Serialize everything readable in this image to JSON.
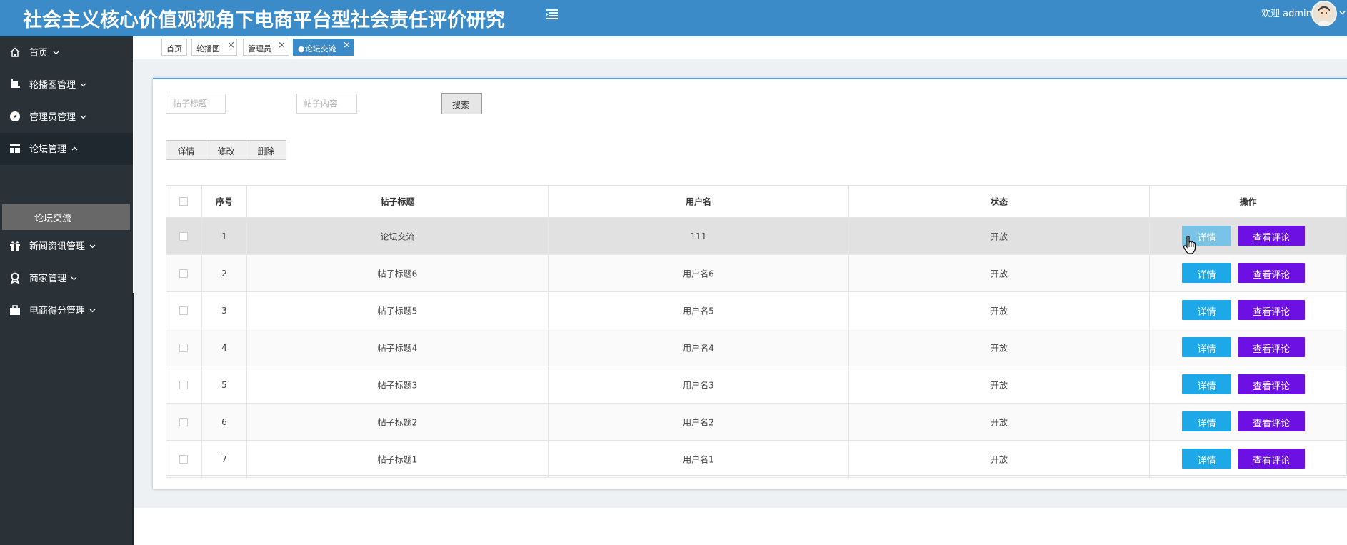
{
  "app": {
    "title": "社会主义核心价值观视角下电商平台型社会责任评价研究",
    "welcome": "欢迎 admin"
  },
  "sidebar": {
    "items": [
      {
        "label": "首页",
        "icon": "home-icon"
      },
      {
        "label": "轮播图管理",
        "icon": "crop-icon"
      },
      {
        "label": "管理员管理",
        "icon": "compass-icon"
      },
      {
        "label": "论坛管理",
        "icon": "layout-icon",
        "expanded": true
      },
      {
        "label": "新闻资讯管理",
        "icon": "gift-icon"
      },
      {
        "label": "商家管理",
        "icon": "award-icon"
      },
      {
        "label": "电商得分管理",
        "icon": "briefcase-icon"
      }
    ],
    "sub_item": "论坛交流"
  },
  "tabs": [
    {
      "label": "首页",
      "closable": false
    },
    {
      "label": "轮播图",
      "closable": true
    },
    {
      "label": "管理员",
      "closable": true
    },
    {
      "label": "●论坛交流",
      "closable": true,
      "active": true
    }
  ],
  "search": {
    "title_placeholder": "帖子标题",
    "content_placeholder": "帖子内容",
    "button": "搜索"
  },
  "toolbar": {
    "detail": "详情",
    "edit": "修改",
    "delete": "删除"
  },
  "table": {
    "headers": {
      "index": "序号",
      "title": "帖子标题",
      "username": "用户名",
      "status": "状态",
      "actions": "操作"
    },
    "rows": [
      {
        "index": "1",
        "title": "论坛交流",
        "username": "111",
        "status": "开放"
      },
      {
        "index": "2",
        "title": "帖子标题6",
        "username": "用户名6",
        "status": "开放"
      },
      {
        "index": "3",
        "title": "帖子标题5",
        "username": "用户名5",
        "status": "开放"
      },
      {
        "index": "4",
        "title": "帖子标题4",
        "username": "用户名4",
        "status": "开放"
      },
      {
        "index": "5",
        "title": "帖子标题3",
        "username": "用户名3",
        "status": "开放"
      },
      {
        "index": "6",
        "title": "帖子标题2",
        "username": "用户名2",
        "status": "开放"
      },
      {
        "index": "7",
        "title": "帖子标题1",
        "username": "用户名1",
        "status": "开放"
      }
    ],
    "detail_button": "详情",
    "comment_button": "查看评论"
  },
  "colors": {
    "header": "#3a8bc8",
    "sidebar": "#2a3238",
    "detail_button": "#1fa8e8",
    "comment_button": "#6c10e4"
  }
}
